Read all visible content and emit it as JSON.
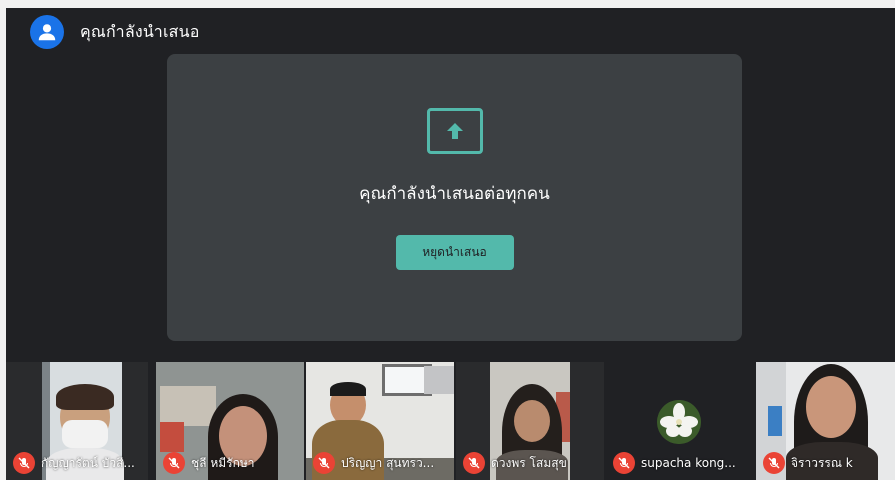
{
  "presenter": {
    "label": "คุณกำลังนำเสนอ"
  },
  "panel": {
    "icon": "present-to-all-icon",
    "title": "คุณกำลังนำเสนอต่อทุกคน",
    "stop_label": "หยุดนำเสนอ"
  },
  "colors": {
    "accent": "#53b9ab",
    "background": "#202124",
    "panel": "#3c4043",
    "mic_off": "#ea4335",
    "avatar": "#1a73e8"
  },
  "participants": [
    {
      "name": "กัญญารัตน์ บัวสี...",
      "mic": "mic-off-icon"
    },
    {
      "name": "ชุลี หมีรักษา",
      "mic": "mic-off-icon"
    },
    {
      "name": "ปริญญา สุนทรว...",
      "mic": "mic-off-icon"
    },
    {
      "name": "ดวงพร โสมสุข",
      "mic": "mic-off-icon"
    },
    {
      "name": "supacha kong...",
      "mic": "mic-off-icon"
    },
    {
      "name": "จิราวรรณ k",
      "mic": "mic-off-icon"
    }
  ]
}
